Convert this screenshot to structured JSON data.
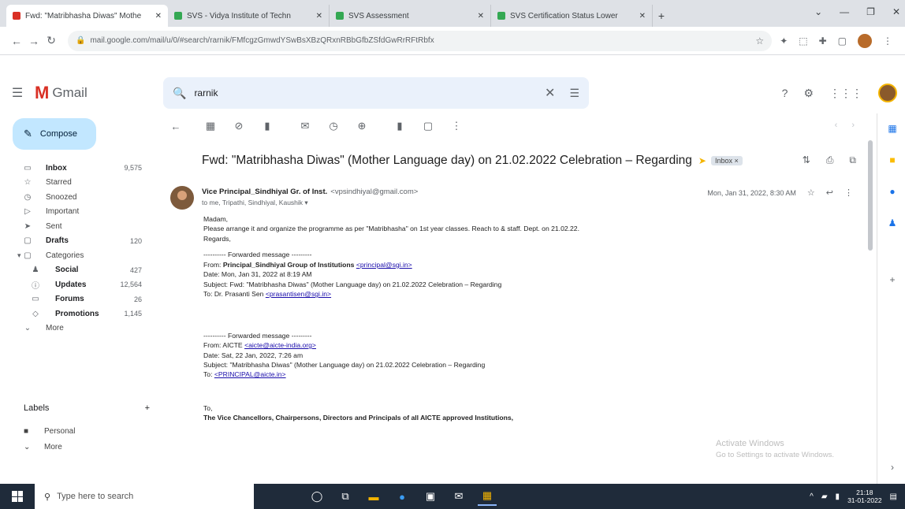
{
  "browser": {
    "tabs": [
      {
        "title": "Fwd: \"Matribhasha Diwas\" Mothe",
        "favicon_color": "#d93025",
        "active": true
      },
      {
        "title": "SVS - Vidya Institute of Techn",
        "favicon_color": "#34a853",
        "active": false
      },
      {
        "title": "SVS Assessment",
        "favicon_color": "#34a853",
        "active": false
      },
      {
        "title": "SVS Certification Status Lower",
        "favicon_color": "#34a853",
        "active": false
      }
    ],
    "new_tab": "+",
    "window_controls": [
      "⌄",
      "—",
      "❐",
      "✕"
    ],
    "url": "mail.google.com/mail/u/0/#search/rarnik/FMfcgzGmwdYSwBsXBzQRxnRBbGfbZSfdGwRrRFtRbfx",
    "nav": {
      "back": "←",
      "forward": "→",
      "reload": "↻"
    }
  },
  "gmail": {
    "logo_letter": "M",
    "logo_word": "Gmail",
    "search": {
      "value": "rarnik",
      "clear": "✕",
      "options": "☰"
    },
    "header_icons": [
      "?",
      "⚙",
      "⋮⋮⋮"
    ]
  },
  "sidebar": {
    "compose": "Compose",
    "items": [
      {
        "icon": "▭",
        "label": "Inbox",
        "count": "9,575",
        "bold": true
      },
      {
        "icon": "☆",
        "label": "Starred",
        "count": ""
      },
      {
        "icon": "◷",
        "label": "Snoozed",
        "count": ""
      },
      {
        "icon": "▷",
        "label": "Important",
        "count": ""
      },
      {
        "icon": "➤",
        "label": "Sent",
        "count": ""
      },
      {
        "icon": "▢",
        "label": "Drafts",
        "count": "120",
        "bold": true
      },
      {
        "icon": "▢",
        "label": "Categories",
        "count": "",
        "expand": "▾"
      }
    ],
    "sub_items": [
      {
        "icon": "♟",
        "label": "Social",
        "count": "427"
      },
      {
        "icon": "ⓘ",
        "label": "Updates",
        "count": "12,564"
      },
      {
        "icon": "▭",
        "label": "Forums",
        "count": "26"
      },
      {
        "icon": "◇",
        "label": "Promotions",
        "count": "1,145"
      }
    ],
    "more": "More",
    "labels_header": "Labels",
    "labels_add": "+",
    "labels": [
      {
        "icon": "■",
        "label": "Personal"
      },
      {
        "icon": "⌄",
        "label": "More"
      }
    ]
  },
  "toolbar": {
    "icons": [
      "←",
      "▦",
      "⊘",
      "▮",
      "✉",
      "◷",
      "⊕",
      "▮",
      "▢",
      "⋮"
    ],
    "pager": [
      "‹",
      "›"
    ]
  },
  "message": {
    "subject": "Fwd: \"Matribhasha Diwas\" (Mother Language day) on 21.02.2022 Celebration – Regarding",
    "important_marker": "➤",
    "label_chip": "Inbox ×",
    "subject_icons": [
      "⇅",
      "⎙",
      "⧉"
    ],
    "sender_name": "Vice Principal_Sindhiyal Gr. of Inst.",
    "sender_email": "<vpsindhiyal@gmail.com>",
    "to_line": "to me, Tripathi, Sindhiyal, Kaushik ▾",
    "date": "Mon, Jan 31, 2022, 8:30 AM",
    "meta_icons": [
      "☆",
      "↩",
      "⋮"
    ],
    "body": {
      "greeting": "Madam,",
      "line1": "Please arrange it and organize the programme as per \"Matribhasha\" on 1st year classes. Reach to & staff. Dept. on 21.02.22.",
      "regards": "Regards,",
      "fwd1_header": "---------- Forwarded message ---------",
      "fwd1_from_label": "From: ",
      "fwd1_from_name": "Principal_Sindhiyal Group of Institutions",
      "fwd1_from_email": "<principal@sgi.in>",
      "fwd1_date": "Date: Mon, Jan 31, 2022 at 8:19 AM",
      "fwd1_subject": "Subject: Fwd: \"Matribhasha Diwas\" (Mother Language day) on 21.02.2022 Celebration – Regarding",
      "fwd1_to_label": "To: Dr. Prasanti Sen ",
      "fwd1_to_email": "<prasantisen@sgi.in>",
      "fwd2_header": "---------- Forwarded message ---------",
      "fwd2_from_label": "From: ",
      "fwd2_from_name": "AICTE",
      "fwd2_from_email": "<aicte@aicte-india.org>",
      "fwd2_date": "Date: Sat, 22 Jan, 2022, 7:26 am",
      "fwd2_subject": "Subject: \"Matribhasha Diwas\" (Mother Language day) on 21.02.2022 Celebration – Regarding",
      "fwd2_to_label": "To: ",
      "fwd2_to_email": "<PRINCIPAL@aicte.in>",
      "to_line": "To,",
      "addressees": "The Vice Chancellors, Chairpersons, Directors and Principals of all AICTE approved Institutions,"
    }
  },
  "watermark": {
    "line1": "Activate Windows",
    "line2": "Go to Settings to activate Windows."
  },
  "sidepanel_icons": [
    {
      "name": "calendar-icon",
      "glyph": "▦",
      "color": "#1a73e8"
    },
    {
      "name": "keep-icon",
      "glyph": "■",
      "color": "#fbbc04"
    },
    {
      "name": "tasks-icon",
      "glyph": "●",
      "color": "#1a73e8"
    },
    {
      "name": "contacts-icon",
      "glyph": "♟",
      "color": "#1a73e8"
    },
    {
      "name": "add-addon-icon",
      "glyph": "+",
      "color": "#5f6368"
    },
    {
      "name": "expand-panel-icon",
      "glyph": "›",
      "color": "#5f6368"
    }
  ],
  "taskbar": {
    "search_placeholder": "Type here to search",
    "apps": [
      "◯",
      "⧉",
      "▬",
      "●",
      "▣",
      "✉",
      "▦"
    ],
    "tray_icons": [
      "^",
      "▰",
      "▮"
    ],
    "time": "21:18",
    "date": "31-01-2022"
  }
}
